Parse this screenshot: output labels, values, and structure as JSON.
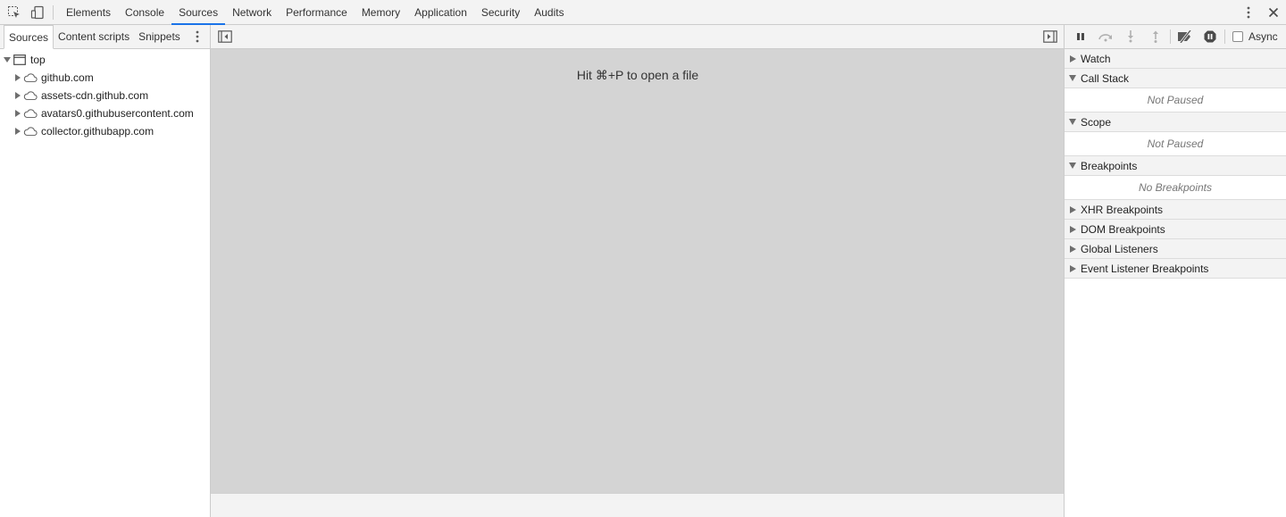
{
  "toolbar": {
    "inspect_icon": "inspect-element-icon",
    "device_icon": "device-toolbar-icon",
    "tabs": [
      {
        "label": "Elements"
      },
      {
        "label": "Console"
      },
      {
        "label": "Sources"
      },
      {
        "label": "Network"
      },
      {
        "label": "Performance"
      },
      {
        "label": "Memory"
      },
      {
        "label": "Application"
      },
      {
        "label": "Security"
      },
      {
        "label": "Audits"
      }
    ],
    "selected_tab": "Sources",
    "accent_color": "#1a73e8"
  },
  "navigator": {
    "tabs": [
      {
        "label": "Sources"
      },
      {
        "label": "Content scripts"
      },
      {
        "label": "Snippets"
      }
    ],
    "tree": {
      "root": {
        "label": "top"
      },
      "domains": [
        {
          "label": "github.com"
        },
        {
          "label": "assets-cdn.github.com"
        },
        {
          "label": "avatars0.githubusercontent.com"
        },
        {
          "label": "collector.githubapp.com"
        }
      ]
    }
  },
  "editor": {
    "hint": "Hit ⌘+P to open a file",
    "background": "#d4d4d4"
  },
  "debugger": {
    "async_label": "Async",
    "sections": {
      "watch": {
        "title": "Watch"
      },
      "call_stack": {
        "title": "Call Stack",
        "status": "Not Paused"
      },
      "scope": {
        "title": "Scope",
        "status": "Not Paused"
      },
      "breakpoints": {
        "title": "Breakpoints",
        "status": "No Breakpoints"
      },
      "xhr": {
        "title": "XHR Breakpoints"
      },
      "dom": {
        "title": "DOM Breakpoints"
      },
      "global": {
        "title": "Global Listeners"
      },
      "event": {
        "title": "Event Listener Breakpoints"
      }
    }
  }
}
